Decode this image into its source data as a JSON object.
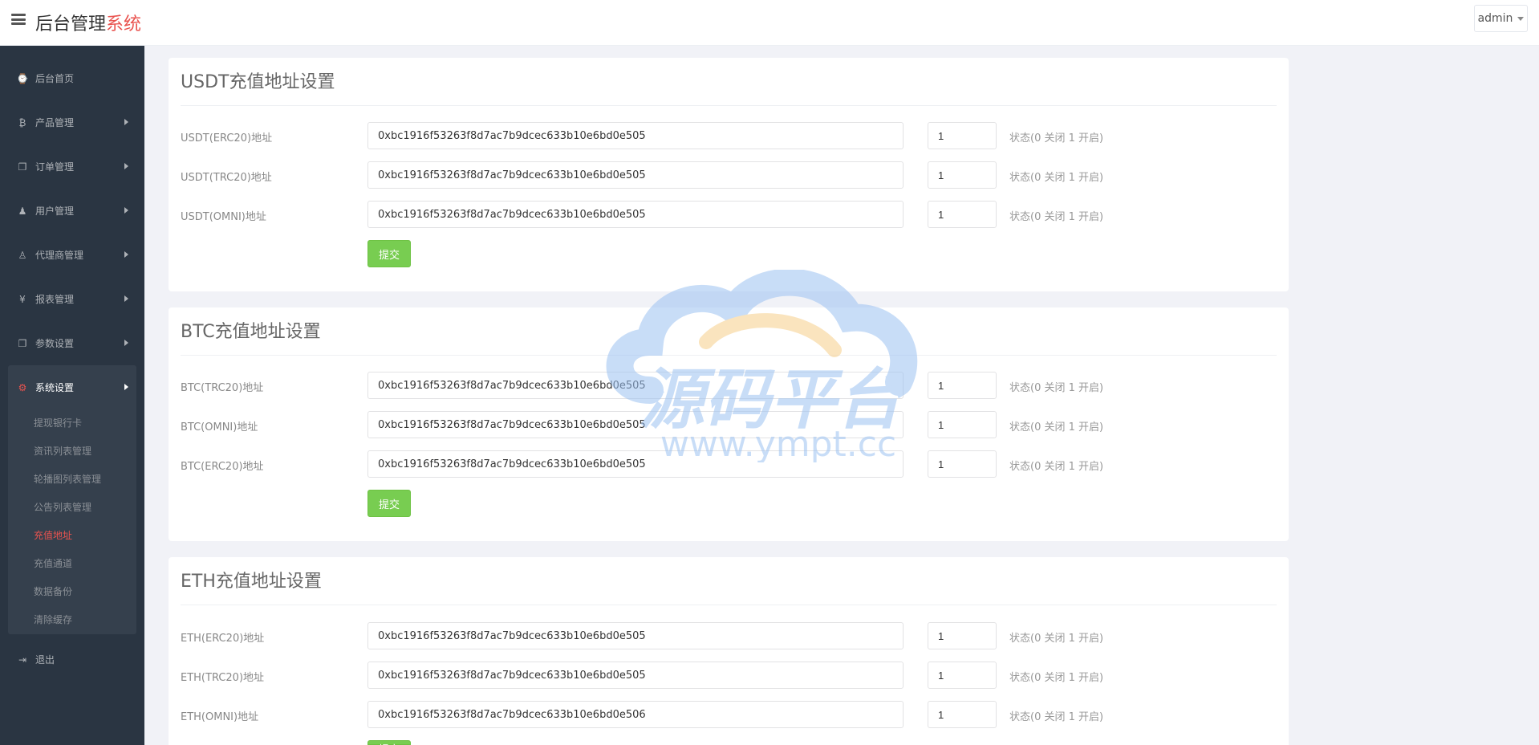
{
  "header": {
    "brand_main": "后台管理",
    "brand_accent": "系统",
    "user": "admin"
  },
  "sidebar": {
    "items": [
      {
        "label": "后台首页",
        "icon": "dashboard-icon",
        "glyph": "⌚"
      },
      {
        "label": "产品管理",
        "icon": "bitcoin-icon",
        "glyph": "₿"
      },
      {
        "label": "订单管理",
        "icon": "copy-icon",
        "glyph": "❐"
      },
      {
        "label": "用户管理",
        "icon": "user-icon",
        "glyph": "♟"
      },
      {
        "label": "代理商管理",
        "icon": "agent-icon",
        "glyph": "♙"
      },
      {
        "label": "报表管理",
        "icon": "yen-icon",
        "glyph": "¥"
      },
      {
        "label": "参数设置",
        "icon": "copy-icon",
        "glyph": "❐"
      }
    ],
    "active_group": {
      "label": "系统设置",
      "icon": "cogs-icon",
      "glyph": "⚙",
      "subitems": [
        "提现银行卡",
        "资讯列表管理",
        "轮播图列表管理",
        "公告列表管理",
        "充值地址",
        "充值通道",
        "数据备份",
        "清除缓存"
      ],
      "active_sub": "充值地址"
    },
    "logout": {
      "label": "退出",
      "icon": "sign-out-icon",
      "glyph": "⇥"
    }
  },
  "watermark": {
    "text_cn": "源码平台",
    "text_url": "www.ympt.cc"
  },
  "panels": [
    {
      "title": "USDT充值地址设置",
      "rows": [
        {
          "label": "USDT(ERC20)地址",
          "address": "0xbc1916f53263f8d7ac7b9dcec633b10e6bd0e505",
          "status": "1",
          "hint": "状态(0 关闭 1 开启)"
        },
        {
          "label": "USDT(TRC20)地址",
          "address": "0xbc1916f53263f8d7ac7b9dcec633b10e6bd0e505",
          "status": "1",
          "hint": "状态(0 关闭 1 开启)"
        },
        {
          "label": "USDT(OMNI)地址",
          "address": "0xbc1916f53263f8d7ac7b9dcec633b10e6bd0e505",
          "status": "1",
          "hint": "状态(0 关闭 1 开启)"
        }
      ],
      "submit": "提交"
    },
    {
      "title": "BTC充值地址设置",
      "rows": [
        {
          "label": "BTC(TRC20)地址",
          "address": "0xbc1916f53263f8d7ac7b9dcec633b10e6bd0e505",
          "status": "1",
          "hint": "状态(0 关闭 1 开启)"
        },
        {
          "label": "BTC(OMNI)地址",
          "address": "0xbc1916f53263f8d7ac7b9dcec633b10e6bd0e505",
          "status": "1",
          "hint": "状态(0 关闭 1 开启)"
        },
        {
          "label": "BTC(ERC20)地址",
          "address": "0xbc1916f53263f8d7ac7b9dcec633b10e6bd0e505",
          "status": "1",
          "hint": "状态(0 关闭 1 开启)"
        }
      ],
      "submit": "提交"
    },
    {
      "title": "ETH充值地址设置",
      "rows": [
        {
          "label": "ETH(ERC20)地址",
          "address": "0xbc1916f53263f8d7ac7b9dcec633b10e6bd0e505",
          "status": "1",
          "hint": "状态(0 关闭 1 开启)"
        },
        {
          "label": "ETH(TRC20)地址",
          "address": "0xbc1916f53263f8d7ac7b9dcec633b10e6bd0e505",
          "status": "1",
          "hint": "状态(0 关闭 1 开启)"
        },
        {
          "label": "ETH(OMNI)地址",
          "address": "0xbc1916f53263f8d7ac7b9dcec633b10e6bd0e506",
          "status": "1",
          "hint": "状态(0 关闭 1 开启)"
        }
      ],
      "submit": "提交"
    }
  ]
}
